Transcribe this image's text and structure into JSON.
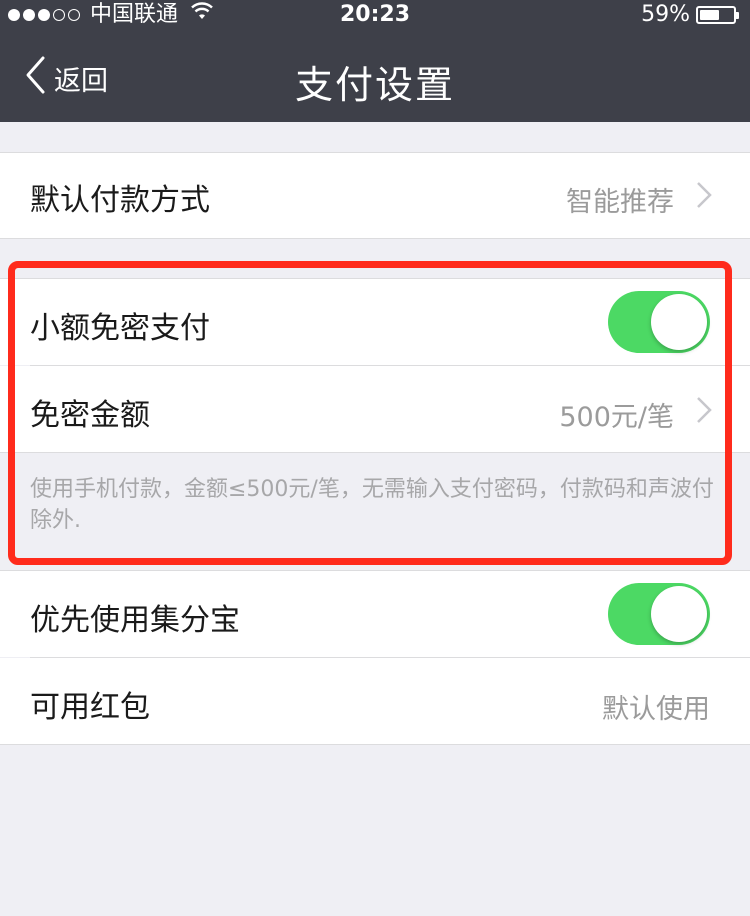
{
  "status_bar": {
    "carrier": "中国联通",
    "time": "20:23",
    "battery": "59%",
    "battery_level": 0.59,
    "signal_bars_filled": 3,
    "signal_bars_total": 5
  },
  "nav": {
    "back_label": "返回",
    "title": "支付设置"
  },
  "rows": {
    "default_payment": {
      "label": "默认付款方式",
      "value": "智能推荐"
    },
    "small_password_free": {
      "label": "小额免密支付",
      "enabled": true
    },
    "password_free_amount": {
      "label": "免密金额",
      "value": "500元/笔"
    },
    "note": "使用手机付款，金额≤500元/笔，无需输入支付密码，付款码和声波付除外.",
    "prefer_jifenbao": {
      "label": "优先使用集分宝",
      "enabled": true
    },
    "red_packet": {
      "label": "可用红包",
      "value": "默认使用"
    }
  },
  "colors": {
    "header_bg": "#3e4049",
    "toggle_on": "#4cd964",
    "highlight": "#ff2b1c"
  }
}
